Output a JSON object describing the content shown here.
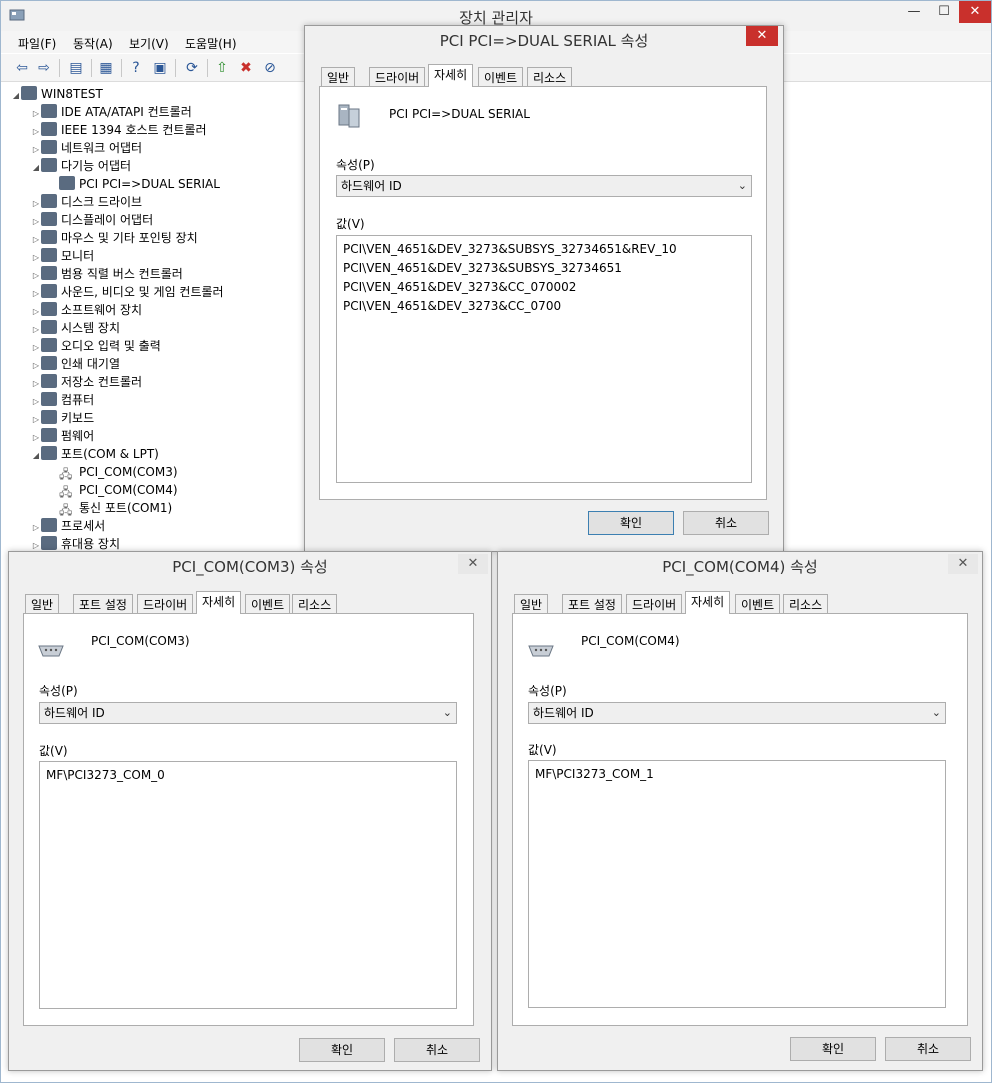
{
  "device_manager": {
    "title": "장치 관리자",
    "menu": [
      "파일(F)",
      "동작(A)",
      "보기(V)",
      "도움말(H)"
    ],
    "tree": [
      {
        "label": "WIN8TEST",
        "level": 0,
        "expanded": true
      },
      {
        "label": "IDE ATA/ATAPI 컨트롤러",
        "level": 1
      },
      {
        "label": "IEEE 1394 호스트 컨트롤러",
        "level": 1
      },
      {
        "label": "네트워크 어댑터",
        "level": 1
      },
      {
        "label": "다기능 어댑터",
        "level": 1,
        "expanded": true
      },
      {
        "label": "PCI PCI=>DUAL SERIAL",
        "level": 2
      },
      {
        "label": "디스크 드라이브",
        "level": 1
      },
      {
        "label": "디스플레이 어댑터",
        "level": 1
      },
      {
        "label": "마우스 및 기타 포인팅 장치",
        "level": 1
      },
      {
        "label": "모니터",
        "level": 1
      },
      {
        "label": "범용 직렬 버스 컨트롤러",
        "level": 1
      },
      {
        "label": "사운드, 비디오 및 게임 컨트롤러",
        "level": 1
      },
      {
        "label": "소프트웨어 장치",
        "level": 1
      },
      {
        "label": "시스템 장치",
        "level": 1
      },
      {
        "label": "오디오 입력 및 출력",
        "level": 1
      },
      {
        "label": "인쇄 대기열",
        "level": 1
      },
      {
        "label": "저장소 컨트롤러",
        "level": 1
      },
      {
        "label": "컴퓨터",
        "level": 1
      },
      {
        "label": "키보드",
        "level": 1
      },
      {
        "label": "펌웨어",
        "level": 1
      },
      {
        "label": "포트(COM & LPT)",
        "level": 1,
        "expanded": true
      },
      {
        "label": "PCI_COM(COM3)",
        "level": 2,
        "port": true
      },
      {
        "label": "PCI_COM(COM4)",
        "level": 2,
        "port": true
      },
      {
        "label": "통신 포트(COM1)",
        "level": 2,
        "port": true
      },
      {
        "label": "프로세서",
        "level": 1
      },
      {
        "label": "휴대용 장치",
        "level": 1
      }
    ]
  },
  "dialogs": {
    "serial": {
      "title": "PCI PCI=>DUAL SERIAL 속성",
      "tabs": [
        "일반",
        "드라이버",
        "자세히",
        "이벤트",
        "리소스"
      ],
      "device_name": "PCI PCI=>DUAL SERIAL",
      "property_label": "속성(P)",
      "property_value": "하드웨어 ID",
      "value_label": "값(V)",
      "values": [
        "PCI\\VEN_4651&DEV_3273&SUBSYS_32734651&REV_10",
        "PCI\\VEN_4651&DEV_3273&SUBSYS_32734651",
        "PCI\\VEN_4651&DEV_3273&CC_070002",
        "PCI\\VEN_4651&DEV_3273&CC_0700"
      ],
      "ok": "확인",
      "cancel": "취소"
    },
    "com3": {
      "title": "PCI_COM(COM3) 속성",
      "tabs": [
        "일반",
        "포트 설정",
        "드라이버",
        "자세히",
        "이벤트",
        "리소스"
      ],
      "device_name": "PCI_COM(COM3)",
      "property_label": "속성(P)",
      "property_value": "하드웨어 ID",
      "value_label": "값(V)",
      "values": [
        "MF\\PCI3273_COM_0"
      ],
      "ok": "확인",
      "cancel": "취소"
    },
    "com4": {
      "title": "PCI_COM(COM4) 속성",
      "tabs": [
        "일반",
        "포트 설정",
        "드라이버",
        "자세히",
        "이벤트",
        "리소스"
      ],
      "device_name": "PCI_COM(COM4)",
      "property_label": "속성(P)",
      "property_value": "하드웨어 ID",
      "value_label": "값(V)",
      "values": [
        "MF\\PCI3273_COM_1"
      ],
      "ok": "확인",
      "cancel": "취소"
    }
  }
}
